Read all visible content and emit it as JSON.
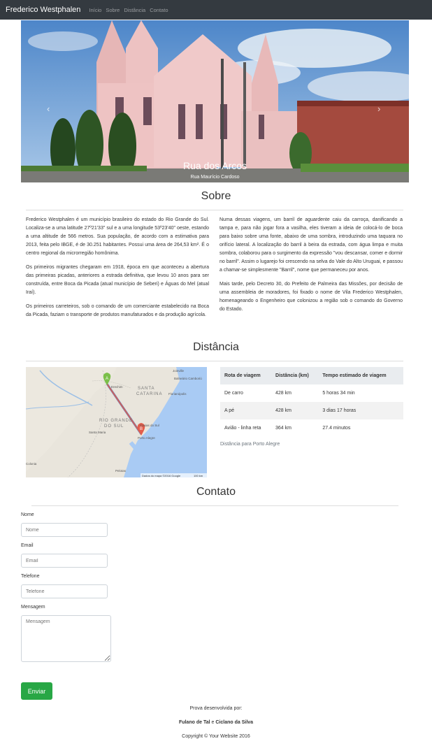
{
  "navbar": {
    "brand": "Frederico Westphalen",
    "links": [
      "Início",
      "Sobre",
      "Distância",
      "Contato"
    ]
  },
  "carousel": {
    "title": "Rua dos Arcos",
    "subtitle": "Rua Maurício Cardoso",
    "prev_icon": "chevron-left-icon",
    "next_icon": "chevron-right-icon",
    "indicators": 3
  },
  "sobre": {
    "heading": "Sobre",
    "left_paragraphs": [
      "Frederico Westphalen é um município brasileiro do estado do Rio Grande do Sul. Localiza-se a uma latitude 27º21'33\" sul e a uma longitude 53º23'40\" oeste, estando a uma altitude de 566 metros. Sua população, de acordo com a estimativa para 2013, feita pelo IBGE, é de 30.251 habitantes. Possui uma área de 264,53 km². É o centro regional da microrregião homônima.",
      "Os primeiros migrantes chegaram em 1918, época em que aconteceu a abertura das primeiras picadas, anteriores a estrada definitiva, que levou 10 anos para ser construída, entre Boca da Picada (atual município de Seberi) e Águas do Mel (atual Iraí).",
      "Os primeiros carreteiros, sob o comando de um comerciante estabelecido na Boca da Picada, faziam o transporte de produtos manufaturados e da produção agrícola."
    ],
    "right_paragraphs": [
      "Numa dessas viagens, um barril de aguardente caiu da carroça, danificando a tampa e, para não jogar fora a vasilha, eles tiveram a ideia de colocá-lo de boca para baixo sobre uma fonte, abaixo de uma sombra, introduzindo uma taquara no orifício lateral. A localização do barril à beira da estrada, com água limpa e muita sombra, colaborou para o surgimento da expressão \"vou descansar, comer e dormir no barril\". Assim o lugarejo foi crescendo na selva do Vale do Alto Uruguai, e passou a chamar-se simplesmente \"Barril\", nome que permaneceu por anos.",
      "Mais tarde, pelo Decreto 30, do Prefeito de Palmeira das Missões, por decisão de uma assembleia de moradores, foi fixado o nome de Vila Frederico Westphalen, homenageando o Engenheiro que colonizou a região sob o comando do Governo do Estado."
    ]
  },
  "distancia": {
    "heading": "Distância",
    "map": {
      "labels": [
        "Joinville",
        "Balneário Camboriú",
        "Florianópolis",
        "SANTA",
        "CATARINA",
        "Erechim",
        "RIO GRANDE",
        "DO SUL",
        "Santa Maria",
        "Caxias do Sul",
        "Porto Alegre",
        "Pelotas",
        "Colonia"
      ],
      "marker_a": "A",
      "marker_b": "B",
      "attribution": "Dados do mapa ©2016 Google",
      "scale": "100 km"
    },
    "table": {
      "headers": [
        "Rota de viagem",
        "Distância (km)",
        "Tempo estimado de viagem"
      ],
      "rows": [
        [
          "De carro",
          "428 km",
          "5 horas 34 min"
        ],
        [
          "A pé",
          "428 km",
          "3 dias 17 horas"
        ],
        [
          "Avião - linha reta",
          "364 km",
          "27.4 minutos"
        ]
      ],
      "caption": "Distância para Porto Alegre"
    }
  },
  "contato": {
    "heading": "Contato",
    "name_label": "Nome",
    "name_placeholder": "Nome",
    "email_label": "Email",
    "email_placeholder": "Email",
    "phone_label": "Telefone",
    "phone_placeholder": "Telefone",
    "message_label": "Mensagem",
    "message_placeholder": "Mensagem",
    "submit_label": "Enviar",
    "submit_color": "#28a745"
  },
  "footer": {
    "developed_by": "Prova desenvolvida por:",
    "author1": "Fulano de Tal",
    "connector": "e",
    "author2": "Ciclano da Silva",
    "copyright": "Copyright © Your Website 2016"
  }
}
